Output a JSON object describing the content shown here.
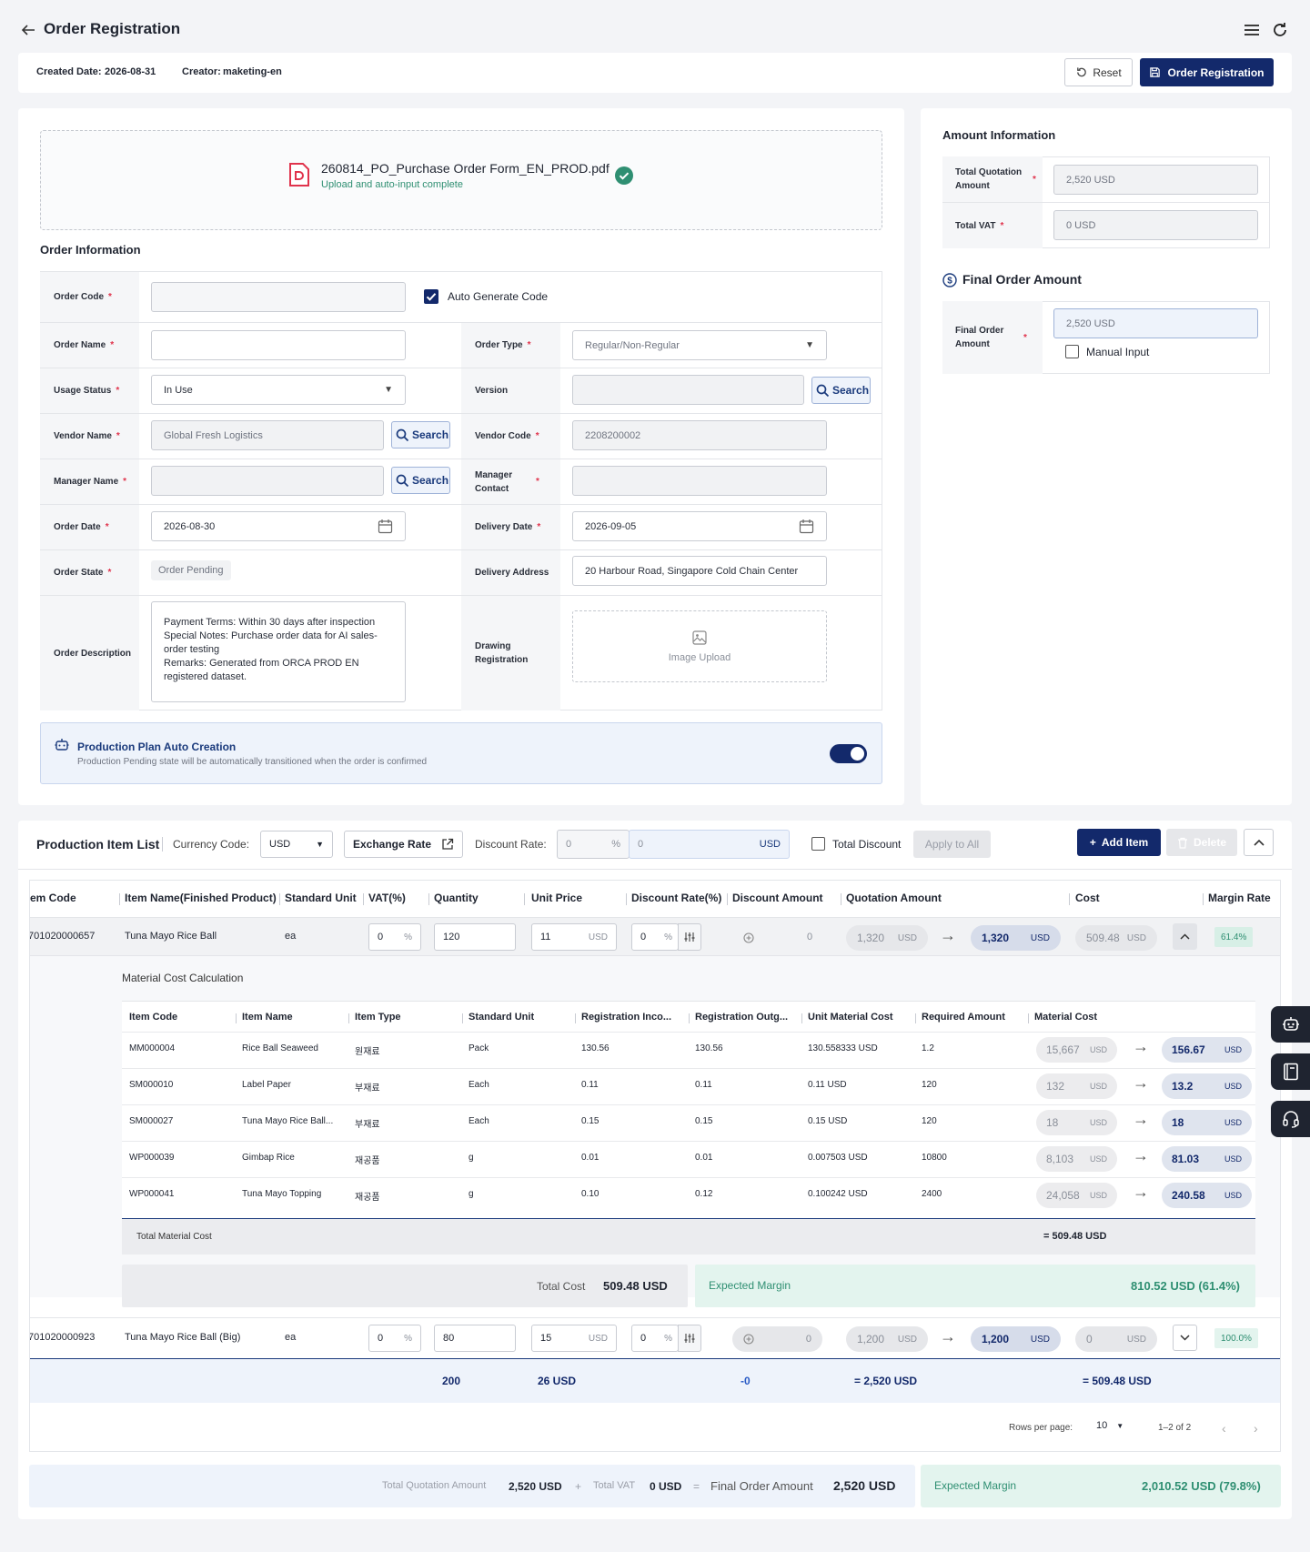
{
  "header": {
    "title": "Order Registration"
  },
  "infobar": {
    "created_label": "Created Date:",
    "created_value": "2026-08-31",
    "creator_label": "Creator:",
    "creator_value": "maketing-en",
    "reset_label": "Reset",
    "register_label": "Order Registration"
  },
  "upload": {
    "filename": "260814_PO_Purchase Order Form_EN_PROD.pdf",
    "status": "Upload and auto-input complete"
  },
  "order_info": {
    "section_title": "Order Information",
    "order_code_label": "Order Code",
    "auto_generate_label": "Auto Generate Code",
    "order_name_label": "Order Name",
    "order_type_label": "Order Type",
    "order_type_placeholder": "Regular/Non-Regular",
    "usage_status_label": "Usage Status",
    "usage_status_value": "In Use",
    "version_label": "Version",
    "vendor_name_label": "Vendor Name",
    "vendor_name_value": "Global Fresh Logistics",
    "vendor_code_label": "Vendor Code",
    "vendor_code_value": "2208200002",
    "manager_name_label": "Manager Name",
    "manager_contact_label": "Manager Contact",
    "order_date_label": "Order Date",
    "order_date_value": "2026-08-30",
    "delivery_date_label": "Delivery Date",
    "delivery_date_value": "2026-09-05",
    "order_state_label": "Order State",
    "order_state_value": "Order Pending",
    "delivery_address_label": "Delivery Address",
    "delivery_address_value": "20 Harbour Road, Singapore Cold Chain Center",
    "order_description_label": "Order Description",
    "order_description_value": "Payment Terms: Within 30 days after inspection\nSpecial Notes: Purchase order data for AI sales-order testing\nRemarks: Generated from ORCA PROD EN registered dataset.",
    "drawing_label": "Drawing Registration",
    "image_upload_label": "Image Upload",
    "search_label": "Search"
  },
  "plan": {
    "title": "Production Plan Auto Creation",
    "desc": "Production Pending state will be automatically transitioned when the order is confirmed",
    "enabled": true
  },
  "amount": {
    "title": "Amount Information",
    "total_quotation_label": "Total Quotation Amount",
    "total_quotation_value": "2,520 USD",
    "total_vat_label": "Total VAT",
    "total_vat_value": "0 USD",
    "final_title": "Final Order Amount",
    "final_label": "Final Order Amount",
    "final_value": "2,520 USD",
    "manual_input_label": "Manual Input"
  },
  "items": {
    "title": "Production Item List",
    "currency_label": "Currency Code:",
    "currency_value": "USD",
    "exchange_label": "Exchange Rate",
    "discount_label": "Discount Rate:",
    "discount_pct": "0",
    "pct_unit": "%",
    "discount_amt": "0",
    "discount_unit": "USD",
    "total_discount_label": "Total Discount",
    "apply_all_label": "Apply to All",
    "add_label": "Add Item",
    "delete_label": "Delete",
    "columns": [
      "em Code",
      "Item Name(Finished Product)",
      "Standard Unit",
      "VAT(%)",
      "Quantity",
      "Unit Price",
      "Discount Rate(%)",
      "Discount Amount",
      "Quotation Amount",
      "Cost",
      "Margin Rate"
    ],
    "unit_usd": "USD",
    "unit_pct": "%",
    "rows": [
      {
        "code": "701020000657",
        "name": "Tuna Mayo Rice Ball",
        "unit": "ea",
        "vat": "0",
        "qty": "120",
        "price": "11",
        "disc_rate": "0",
        "disc_amt": "0",
        "quote_from": "1,320",
        "quote_to": "1,320",
        "cost": "509.48",
        "margin": "61.4%"
      },
      {
        "code": "701020000923",
        "name": "Tuna Mayo Rice Ball (Big)",
        "unit": "ea",
        "vat": "0",
        "qty": "80",
        "price": "15",
        "disc_rate": "0",
        "disc_amt": "0",
        "quote_from": "1,200",
        "quote_to": "1,200",
        "cost": "0",
        "margin": "100.0%"
      }
    ],
    "totals": {
      "qty": "200",
      "price": "26 USD",
      "disc": "-0",
      "quote": "= 2,520 USD",
      "cost": "= 509.48 USD"
    },
    "pager": {
      "rows_label": "Rows per page:",
      "rows_value": "10",
      "range": "1–2 of 2"
    }
  },
  "material": {
    "title": "Material Cost Calculation",
    "columns": [
      "Item Code",
      "Item Name",
      "Item Type",
      "Standard Unit",
      "Registration Inco...",
      "Registration Outg...",
      "Unit Material Cost",
      "Required Amount",
      "Material Cost"
    ],
    "rows": [
      {
        "code": "MM000004",
        "name": "Rice Ball Seaweed",
        "type": "원재료",
        "unit": "Pack",
        "inco": "130.56",
        "outg": "130.56",
        "umc": "130.558333 USD",
        "req": "1.2",
        "from": "15,667",
        "to": "156.67"
      },
      {
        "code": "SM000010",
        "name": "Label Paper",
        "type": "부재료",
        "unit": "Each",
        "inco": "0.11",
        "outg": "0.11",
        "umc": "0.11 USD",
        "req": "120",
        "from": "132",
        "to": "13.2"
      },
      {
        "code": "SM000027",
        "name": "Tuna Mayo Rice Ball...",
        "type": "부재료",
        "unit": "Each",
        "inco": "0.15",
        "outg": "0.15",
        "umc": "0.15 USD",
        "req": "120",
        "from": "18",
        "to": "18"
      },
      {
        "code": "WP000039",
        "name": "Gimbap Rice",
        "type": "재공품",
        "unit": "g",
        "inco": "0.01",
        "outg": "0.01",
        "umc": "0.007503 USD",
        "req": "10800",
        "from": "8,103",
        "to": "81.03"
      },
      {
        "code": "WP000041",
        "name": "Tuna Mayo Topping",
        "type": "재공품",
        "unit": "g",
        "inco": "0.10",
        "outg": "0.12",
        "umc": "0.100242 USD",
        "req": "2400",
        "from": "24,058",
        "to": "240.58"
      }
    ],
    "total_label": "Total Material Cost",
    "total_value": "= 509.48 USD",
    "total_cost_label": "Total Cost",
    "total_cost_value": "509.48 USD",
    "margin_label": "Expected Margin",
    "margin_value": "810.52 USD (61.4%)"
  },
  "footer": {
    "tq_label": "Total Quotation Amount",
    "tq_value": "2,520 USD",
    "plus": "+",
    "vat_label": "Total VAT",
    "vat_value": "0 USD",
    "eq": "=",
    "final_label": "Final Order Amount",
    "final_value": "2,520 USD",
    "margin_label": "Expected Margin",
    "margin_value": "2,010.52 USD (79.8%)"
  },
  "colors": {
    "primary": "#13296b",
    "accent_green": "#2f8f72",
    "required": "#e0334c"
  },
  "icons": [
    "back-arrow-icon",
    "menu-icon",
    "refresh-icon",
    "reset-icon",
    "save-icon",
    "pdf-icon",
    "check-circle-icon",
    "search-icon",
    "calendar-icon",
    "chevron-down-icon",
    "image-icon",
    "robot-icon",
    "dollar-icon",
    "external-link-icon",
    "plus-icon",
    "trash-icon",
    "chevron-up-icon",
    "sliders-icon",
    "arrow-right-icon",
    "book-icon",
    "headset-icon"
  ]
}
